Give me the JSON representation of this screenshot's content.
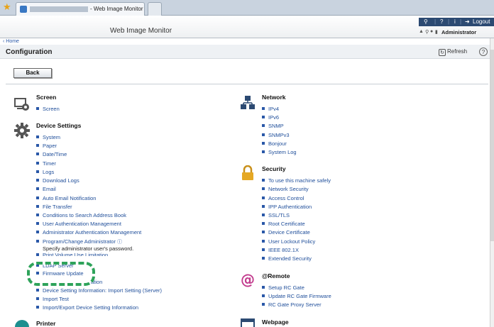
{
  "browser": {
    "tab_title": "- Web Image Monitor"
  },
  "header": {
    "app_title": "Web Image Monitor",
    "topbar": {
      "logout_label": "Logout"
    },
    "user_label": "Administrator"
  },
  "breadcrumb": {
    "home": "Home"
  },
  "page": {
    "title": "Configuration",
    "refresh_label": "Refresh",
    "back_label": "Back"
  },
  "left": {
    "screen": {
      "title": "Screen",
      "items": [
        "Screen"
      ]
    },
    "device_settings": {
      "title": "Device Settings",
      "items": [
        "System",
        "Paper",
        "Date/Time",
        "Timer",
        "Logs",
        "Download Logs",
        "Email",
        "Auto Email Notification",
        "File Transfer",
        "Conditions to Search Address Book",
        "User Authentication Management",
        "Administrator Authentication Management",
        "Program/Change Administrator"
      ],
      "note": "Specify administrator user's password.",
      "partial_items": [
        "Print Volume Use Limitation",
        "LDAP Server"
      ],
      "firmware": "Firmware Update",
      "partial_after_firmware": "ation",
      "after": [
        "Device Setting Information: Import Setting (Server)",
        "Import Test",
        "Import/Export Device Setting Information"
      ]
    },
    "printer": {
      "title": "Printer"
    }
  },
  "right": {
    "network": {
      "title": "Network",
      "items": [
        "IPv4",
        "IPv6",
        "SNMP",
        "SNMPv3",
        "Bonjour",
        "System Log"
      ]
    },
    "security": {
      "title": "Security",
      "items": [
        "To use this machine safely",
        "Network Security",
        "Access Control",
        "IPP Authentication",
        "SSL/TLS",
        "Root Certificate",
        "Device Certificate",
        "User Lockout Policy",
        "IEEE 802.1X",
        "Extended Security"
      ]
    },
    "remote": {
      "title": "@Remote",
      "items": [
        "Setup RC Gate",
        "Update RC Gate Firmware",
        "RC Gate Proxy Server"
      ]
    },
    "webpage": {
      "title": "Webpage"
    }
  },
  "colors": {
    "link": "#1f4e9a",
    "highlight": "#2ea35a",
    "topbar": "#2c4a72"
  }
}
